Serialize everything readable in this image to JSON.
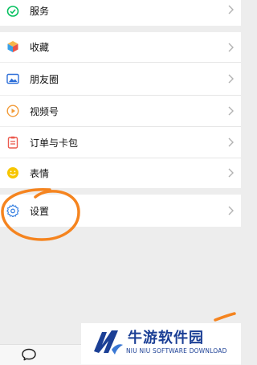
{
  "menu": {
    "services": {
      "label": "服务",
      "icon": "wallet-check-icon",
      "color": "#07c160"
    },
    "favorites": {
      "label": "收藏",
      "icon": "cube-icon"
    },
    "moments": {
      "label": "朋友圈",
      "icon": "image-icon",
      "color": "#2e6fd8"
    },
    "channels": {
      "label": "视频号",
      "icon": "play-circle-icon",
      "color": "#f29b38"
    },
    "orders": {
      "label": "订单与卡包",
      "icon": "clipboard-icon",
      "color": "#ec5a4f"
    },
    "stickers": {
      "label": "表情",
      "icon": "smiley-icon",
      "color": "#f7c600"
    },
    "settings": {
      "label": "设置",
      "icon": "gear-icon",
      "color": "#2f7be0"
    }
  },
  "annotation": {
    "color": "#f5841f"
  },
  "tabbar": {
    "chats_icon": "chat-bubble-icon"
  },
  "watermark": {
    "title": "牛游软件园",
    "subtitle": "NIU NIU SOFTWARE DOWNLOAD",
    "color": "#1b3f95"
  }
}
